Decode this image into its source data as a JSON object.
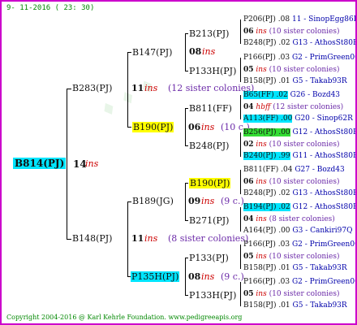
{
  "header": {
    "date": "9- 11-2016 ( 23: 30)"
  },
  "footer": {
    "copyright": "Copyright 2004-2016 @ Karl Kehrle Foundation.",
    "website": "www.pedigreeapis.org"
  },
  "root": {
    "name": "B814(PJ)",
    "num": "14",
    "ins": "ins"
  },
  "g1": [
    {
      "name": "B283(PJ)",
      "num": "11",
      "ins": "ins",
      "sis": "(12 sister colonies)"
    },
    {
      "name": "B148(PJ)",
      "num": "11",
      "ins": "ins",
      "sis": "(8 sister colonies)"
    }
  ],
  "g2": [
    {
      "name": "B147(PJ)"
    },
    {
      "name": "B190(PJ)",
      "num": "06",
      "ins": "ins",
      "sis": "(10 c.)"
    },
    {
      "name": "B189(JG)",
      "num": "09",
      "ins": "ins",
      "sis": "(9 c.)"
    },
    {
      "name": "P135H(PJ)",
      "num": "08",
      "ins": "ins",
      "sis": "(9 c.)"
    }
  ],
  "g3": [
    {
      "name": "B213(PJ)"
    },
    {
      "name": "08",
      "ins": "ins"
    },
    {
      "name": "P133H(PJ)"
    },
    {
      "name": "B811(FF)"
    },
    {
      "name": "B248(PJ)"
    },
    {
      "name": "B190(PJ)"
    },
    {
      "name": "B271(PJ)"
    },
    {
      "name": "P133(PJ)"
    },
    {
      "name": "P133H(PJ)"
    }
  ],
  "g4": [
    {
      "a": "P206(PJ) .08",
      "b": "11 - SinopEgg86R"
    },
    {
      "a": "06",
      "ins": "ins",
      "b": "(10 sister colonies)"
    },
    {
      "a": "B248(PJ) .02",
      "b": "G13 - AthosSt80R"
    },
    {
      "a": "P166(PJ) .03",
      "b": "G2 - PrimGreen00"
    },
    {
      "a": "05",
      "ins": "ins",
      "b": "(10 sister colonies)"
    },
    {
      "a": "B158(PJ) .01",
      "b": "G5 - Takab93R"
    },
    {
      "a": "B65(FF) .02",
      "b": "G26 - Bozd43"
    },
    {
      "a": "04",
      "ins": "hbff",
      "b": "(12 sister colonies)"
    },
    {
      "a": "A113(FF) .00",
      "b": "G20 - Sinop62R"
    },
    {
      "a": "B256(PJ) .00",
      "b": "G12 - AthosSt80R"
    },
    {
      "a": "02",
      "ins": "ins",
      "b": "(10 sister colonies)"
    },
    {
      "a": "B240(PJ) .99",
      "b": "G11 - AthosSt80R"
    },
    {
      "a": "B811(FF) .04",
      "b": "G27 - Bozd43"
    },
    {
      "a": "06",
      "ins": "ins",
      "b": "(10 sister colonies)"
    },
    {
      "a": "B248(PJ) .02",
      "b": "G13 - AthosSt80R"
    },
    {
      "a": "B194(PJ) .02",
      "b": "G12 - AthosSt80R"
    },
    {
      "a": "04",
      "ins": "ins",
      "b": "(8 sister colonies)"
    },
    {
      "a": "A164(PJ) .00",
      "b": "G3 - Cankiri97Q"
    },
    {
      "a": "P166(PJ) .03",
      "b": "G2 - PrimGreen00"
    },
    {
      "a": "05",
      "ins": "ins",
      "b": "(10 sister colonies)"
    },
    {
      "a": "B158(PJ) .01",
      "b": "G5 - Takab93R"
    },
    {
      "a": "P166(PJ) .03",
      "b": "G2 - PrimGreen00"
    },
    {
      "a": "05",
      "ins": "ins",
      "b": "(10 sister colonies)"
    },
    {
      "a": "B158(PJ) .01",
      "b": "G5 - Takab93R"
    }
  ]
}
